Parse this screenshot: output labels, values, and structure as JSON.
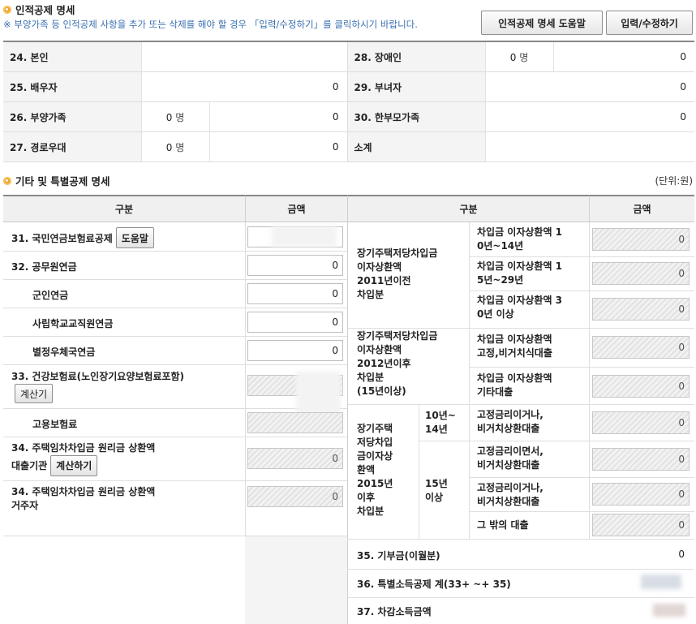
{
  "section1": {
    "title": "인적공제 명세",
    "notice": "※ 부양가족 등 인적공제 사항을 추가 또는 삭제를 해야 할 경우 「입력/수정하기」를 클릭하시기 바랍니다.",
    "help_button": "인적공제 명세 도움말",
    "edit_button": "입력/수정하기",
    "rows": [
      {
        "l_label": "24. 본인",
        "l_count": "",
        "l_value": "",
        "r_label": "28. 장애인",
        "r_count": "0",
        "r_value": "0"
      },
      {
        "l_label": "25. 배우자",
        "l_count": "",
        "l_value": "0",
        "r_label": "29. 부녀자",
        "r_count": "",
        "r_value": "0"
      },
      {
        "l_label": "26. 부양가족",
        "l_count": "0",
        "l_value": "0",
        "r_label": "30. 한부모가족",
        "r_count": "",
        "r_value": "0"
      },
      {
        "l_label": "27. 경로우대",
        "l_count": "0",
        "l_value": "0",
        "r_label": "소계",
        "r_count": "",
        "r_value": ""
      }
    ],
    "unit_person": "명"
  },
  "section2": {
    "title": "기타 및 특별공제 명세",
    "unit_note": "(단위:원)",
    "col_category": "구분",
    "col_amount": "금액",
    "left_rows": {
      "pension": "31. 국민연금보험료공제",
      "help": "도움말",
      "civil": "32. 공무원연금",
      "civil_value": "0",
      "military": "군인연금",
      "military_value": "0",
      "school": "사립학교교직원연금",
      "school_value": "0",
      "post": "별정우체국연금",
      "post_value": "0",
      "health": "33. 건강보험료(노인장기요양보험료포함)",
      "calc": "계산기",
      "employ": "고용보험료",
      "house_lender": "34. 주택임차차입금 원리금 상환액",
      "house_lender2": "대출기관",
      "calc_do": "계산하기",
      "house_lender_value": "0",
      "house_resident": "34. 주택임차차입금 원리금 상환액",
      "house_resident2": "거주자",
      "house_resident_value": "0"
    },
    "right": {
      "g1": [
        "장기주택저당차입금",
        "이자상환액",
        "2011년이전",
        "차입분"
      ],
      "g1_items": [
        {
          "label": [
            "차입금 이자상환액 1",
            "0년~14년"
          ],
          "value": "0"
        },
        {
          "label": [
            "차입금 이자상환액 1",
            "5년~29년"
          ],
          "value": "0"
        },
        {
          "label": [
            "차입금 이자상환액 3",
            "0년 이상"
          ],
          "value": "0"
        }
      ],
      "g2": [
        "장기주택저당차입금",
        "이자상환액",
        "2012년이후",
        "차입분",
        "(15년이상)"
      ],
      "g2_items": [
        {
          "label": [
            "차입금 이자상환액",
            "고정,비거치식대출"
          ],
          "value": "0"
        },
        {
          "label": [
            "차입금 이자상환액",
            "기타대출"
          ],
          "value": "0"
        }
      ],
      "g3": [
        "장기주택",
        "저당차입",
        "금이자상",
        "환액",
        "2015년",
        "이후",
        "차입분"
      ],
      "g3_a": [
        "10년~",
        "14년"
      ],
      "g3_b": [
        "15년",
        "이상"
      ],
      "g3_items": [
        {
          "label": [
            "고정금리이거나,",
            "비거치상환대출"
          ],
          "value": "0"
        },
        {
          "label": [
            "고정금리이면서,",
            "비거치상환대출"
          ],
          "value": "0"
        },
        {
          "label": [
            "고정금리이거나,",
            "비거치상환대출"
          ],
          "value": "0"
        },
        {
          "label": [
            "그 밖의 대출"
          ],
          "value": "0"
        }
      ],
      "donation": "35. 기부금(이월분)",
      "donation_value": "0",
      "special_total": "36. 특별소득공제 계(33+ ~+ 35)",
      "deduct_income": "37. 차감소득금액"
    }
  }
}
